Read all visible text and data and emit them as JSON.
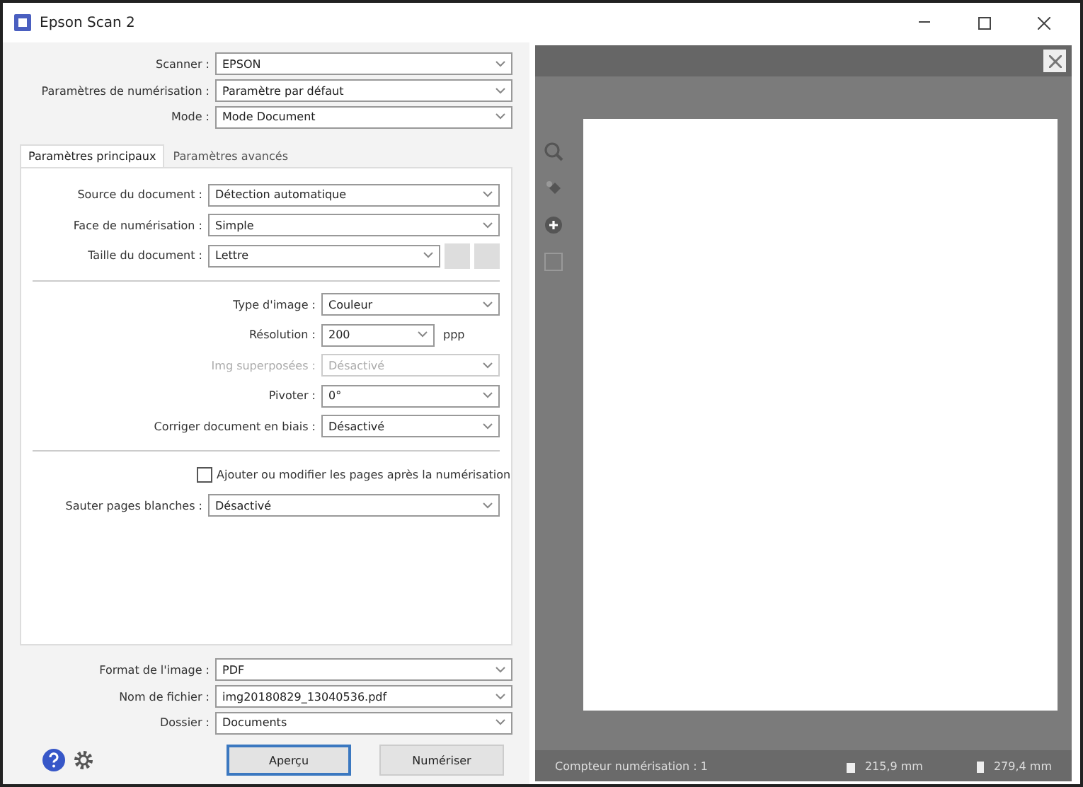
{
  "window": {
    "title": "Epson Scan 2"
  },
  "top_fields": [
    {
      "label": "Scanner :",
      "value": "EPSON"
    },
    {
      "label": "Paramètres de numérisation :",
      "value": "Paramètre par défaut"
    },
    {
      "label": "Mode :",
      "value": "Mode Document"
    }
  ],
  "tabs": [
    {
      "label": "Paramètres principaux",
      "selected": true
    },
    {
      "label": "Paramètres avancés",
      "selected": false
    }
  ],
  "main_settings": [
    {
      "kind": "select",
      "label": "Source du document :",
      "value": "Détection automatique",
      "disabled": false
    },
    {
      "kind": "select",
      "label": "Face de numérisation :",
      "value": "Simple",
      "disabled": false
    },
    {
      "kind": "size",
      "label": "Taille du document :",
      "value": "Lettre",
      "disabled": false
    },
    {
      "kind": "divider"
    },
    {
      "kind": "select",
      "label": "Type d'image :",
      "value": "Couleur",
      "disabled": false
    },
    {
      "kind": "short",
      "label": "Résolution :",
      "value": "200",
      "unit": "ppp",
      "disabled": false
    },
    {
      "kind": "select",
      "label": "Img superposées :",
      "value": "Désactivé",
      "disabled": true
    },
    {
      "kind": "select",
      "label": "Pivoter :",
      "value": "0°",
      "disabled": false
    },
    {
      "kind": "select",
      "label": "Corriger document en biais :",
      "value": "Désactivé",
      "disabled": false
    },
    {
      "kind": "divider"
    },
    {
      "kind": "checkbox",
      "label": "Ajouter ou modifier les pages après la numérisation",
      "checked": false
    },
    {
      "kind": "select",
      "label": "Sauter pages blanches :",
      "value": "Désactivé",
      "disabled": false
    }
  ],
  "output_fields": [
    {
      "label": "Format de l'image :",
      "value": "PDF"
    },
    {
      "label": "Nom de fichier :",
      "value": "img20180829_13040536.pdf"
    },
    {
      "label": "Dossier :",
      "value": "Documents"
    }
  ],
  "buttons": [
    {
      "label": "Aperçu",
      "selected": true
    },
    {
      "label": "Numériser",
      "selected": false
    }
  ],
  "status_bar": {
    "counter": "Compteur numérisation : 1",
    "width": "215,9 mm",
    "height": "279,4 mm"
  }
}
